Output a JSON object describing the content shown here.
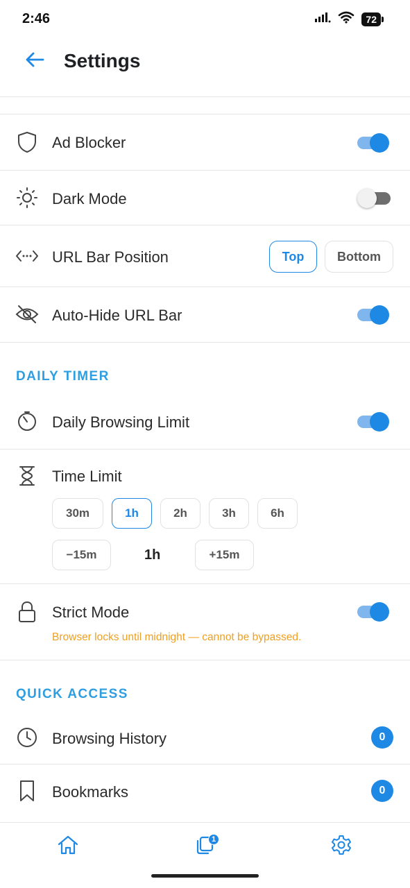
{
  "status_bar": {
    "time": "2:46",
    "battery": "72"
  },
  "header": {
    "title": "Settings"
  },
  "settings": {
    "ad_blocker": {
      "label": "Ad Blocker",
      "enabled": true
    },
    "dark_mode": {
      "label": "Dark Mode",
      "enabled": false
    },
    "url_bar_position": {
      "label": "URL Bar Position",
      "options": [
        "Top",
        "Bottom"
      ],
      "selected": "Top"
    },
    "auto_hide_url_bar": {
      "label": "Auto-Hide URL Bar",
      "enabled": true
    }
  },
  "daily_timer": {
    "section_title": "DAILY TIMER",
    "daily_browsing_limit": {
      "label": "Daily Browsing Limit",
      "enabled": true
    },
    "time_limit": {
      "label": "Time Limit",
      "presets": [
        "30m",
        "1h",
        "2h",
        "3h",
        "6h"
      ],
      "selected": "1h",
      "decrement_label": "−15m",
      "current_value": "1h",
      "increment_label": "+15m"
    },
    "strict_mode": {
      "label": "Strict Mode",
      "enabled": true,
      "warning": "Browser locks until midnight — cannot be bypassed."
    }
  },
  "quick_access": {
    "section_title": "QUICK ACCESS",
    "browsing_history": {
      "label": "Browsing History",
      "count": "0"
    },
    "bookmarks": {
      "label": "Bookmarks",
      "count": "0"
    }
  },
  "bottom_nav": {
    "tabs_badge": "1"
  },
  "colors": {
    "accent": "#1e88e5",
    "section_header": "#2f9ee0",
    "warning": "#f0a020"
  }
}
